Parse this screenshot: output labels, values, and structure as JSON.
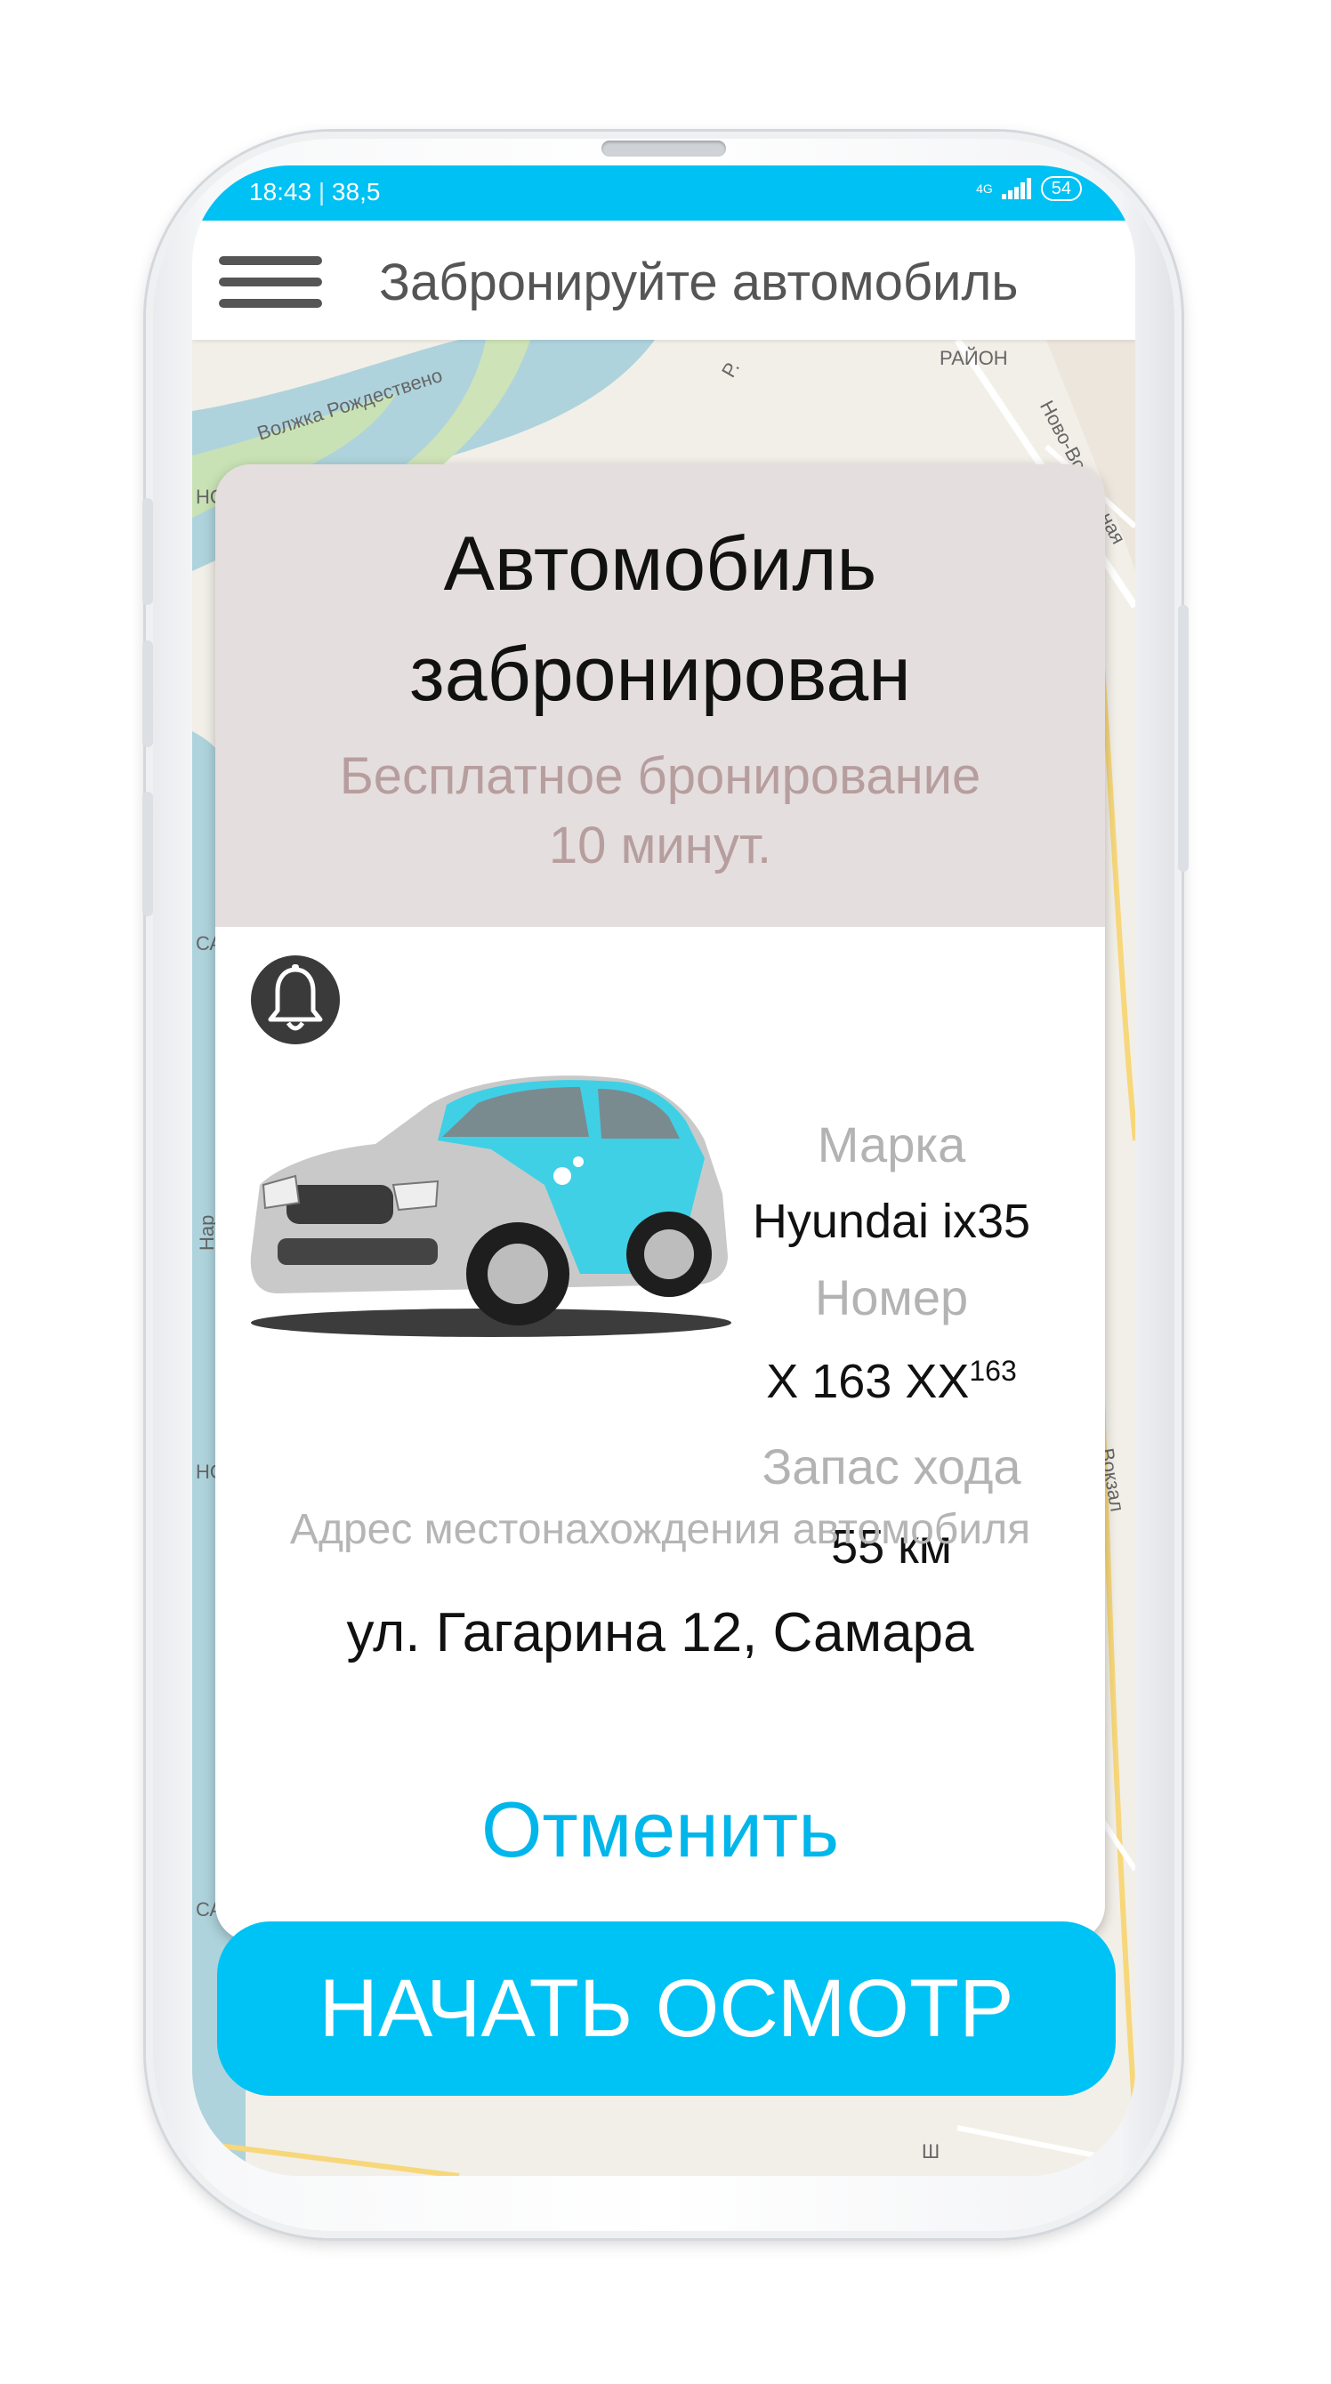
{
  "status_bar": {
    "time": "18:43",
    "speed": "38,5",
    "network": "4G",
    "battery": "54"
  },
  "app_bar": {
    "title": "Забронируйте автомобиль"
  },
  "map": {
    "labels": [
      "РАЙОН",
      "Ново-Вокзальная",
      "Волжка Рождествено",
      "Р.",
      "НО",
      "СА",
      "Нар",
      "НО",
      "Вокзал",
      "СА",
      "Ш"
    ]
  },
  "booking": {
    "title_line1": "Автомобиль",
    "title_line2": "забронирован",
    "subtitle_line1": "Бесплатное бронирование",
    "subtitle_line2": "10 минут.",
    "brand_label": "Марка",
    "brand_value": "Hyundai ix35",
    "plate_label": "Номер",
    "plate_value": "Х 163 ХХ",
    "plate_region": "163",
    "range_label": "Запас хода",
    "range_value": "55 км",
    "address_label": "Адрес местонахождения автомобиля",
    "address_value": "ул. Гагарина 12, Самара",
    "cancel_label": "Отменить",
    "start_label": "НАЧАТЬ ОСМОТР"
  },
  "colors": {
    "accent": "#00c1f3",
    "header_bg": "#e5dede",
    "subtitle": "#b79e9e"
  },
  "icons": [
    "menu-icon",
    "bell-icon",
    "signal-icon",
    "battery-icon"
  ]
}
